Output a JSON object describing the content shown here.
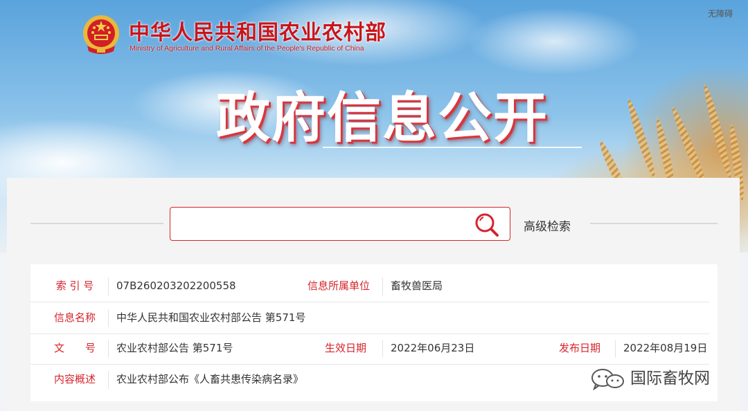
{
  "header": {
    "ministry_name_cn": "中华人民共和国农业农村部",
    "ministry_name_en": "Ministry of Agriculture and Rural Affairs of the People's Republic of China",
    "accessibility_link": "无障碍",
    "hero_title": "政府信息公开"
  },
  "search": {
    "placeholder": "",
    "value": "",
    "icon": "search-icon",
    "advanced_label": "高级检索"
  },
  "info": {
    "index_label": "索 引 号",
    "index_value": "07B260203202200558",
    "unit_label": "信息所属单位",
    "unit_value": "畜牧兽医局",
    "name_label": "信息名称",
    "name_value": "中华人民共和国农业农村部公告 第571号",
    "doc_label": "文　　号",
    "doc_value": "农业农村部公告 第571号",
    "effective_label": "生效日期",
    "effective_value": "2022年06月23日",
    "publish_label": "发布日期",
    "publish_value": "2022年08月19日",
    "summary_label": "内容概述",
    "summary_value": "农业农村部公布《人畜共患传染病名录》"
  },
  "watermark": {
    "icon": "wechat-icon",
    "text": "国际畜牧网"
  },
  "colors": {
    "accent_red": "#d5242b",
    "text_dark": "#333333",
    "sky_blue": "#5aa3dc"
  }
}
